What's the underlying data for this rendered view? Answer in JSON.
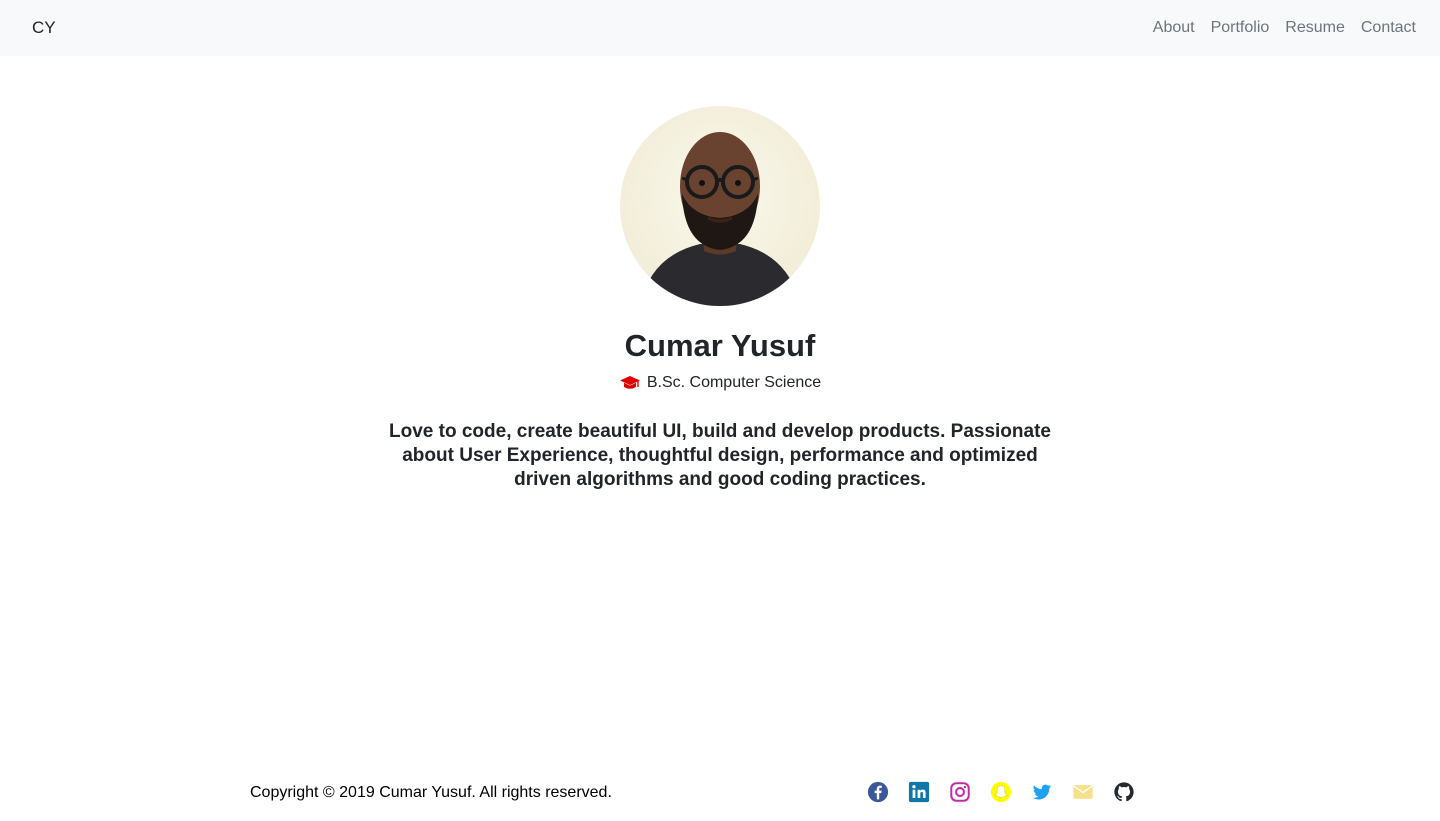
{
  "navbar": {
    "brand": "CY",
    "links": [
      "About",
      "Portfolio",
      "Resume",
      "Contact"
    ]
  },
  "profile": {
    "name": "Cumar Yusuf",
    "degree": "B.Sc. Computer Science",
    "degree_icon": "graduation-cap-icon",
    "bio": "Love to code, create beautiful UI, build and develop products. Passionate about User Experience, thoughtful design, performance and optimized driven algorithms and good coding practices."
  },
  "footer": {
    "copyright": "Copyright © 2019 Cumar Yusuf. All rights reserved.",
    "social_icons": [
      {
        "name": "facebook-icon",
        "color": "#3b5998"
      },
      {
        "name": "linkedin-icon",
        "color": "#0e76a8"
      },
      {
        "name": "instagram-icon",
        "color": "#c32aa3"
      },
      {
        "name": "snapchat-icon",
        "color": "#fffc00"
      },
      {
        "name": "twitter-icon",
        "color": "#1da1f2"
      },
      {
        "name": "email-icon",
        "color": "#f7e08a"
      },
      {
        "name": "github-icon",
        "color": "#24292e"
      }
    ]
  },
  "colors": {
    "navbar_bg": "#f8f9fa",
    "nav_link": "#6c757d",
    "text": "#212529",
    "cap": "#e00000"
  }
}
